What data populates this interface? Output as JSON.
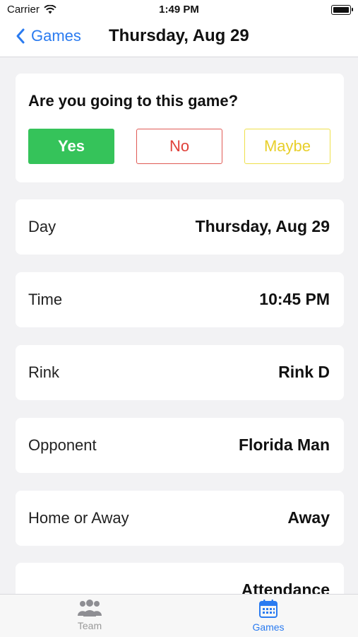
{
  "status_bar": {
    "carrier": "Carrier",
    "time": "1:49 PM"
  },
  "nav": {
    "back_label": "Games",
    "title": "Thursday, Aug 29"
  },
  "rsvp": {
    "question": "Are you going to this game?",
    "yes": "Yes",
    "no": "No",
    "maybe": "Maybe"
  },
  "details": [
    {
      "label": "Day",
      "value": "Thursday, Aug 29"
    },
    {
      "label": "Time",
      "value": "10:45 PM"
    },
    {
      "label": "Rink",
      "value": "Rink D"
    },
    {
      "label": "Opponent",
      "value": "Florida Man"
    },
    {
      "label": "Home or Away",
      "value": "Away"
    }
  ],
  "attendance_label": "Attendance",
  "tabs": [
    {
      "label": "Team",
      "icon": "team-icon"
    },
    {
      "label": "Games",
      "icon": "calendar-icon",
      "selected": true
    }
  ],
  "colors": {
    "accent": "#2a7bf0",
    "yes": "#35c35a",
    "no": "#e0413a",
    "maybe": "#e8cf2a"
  }
}
